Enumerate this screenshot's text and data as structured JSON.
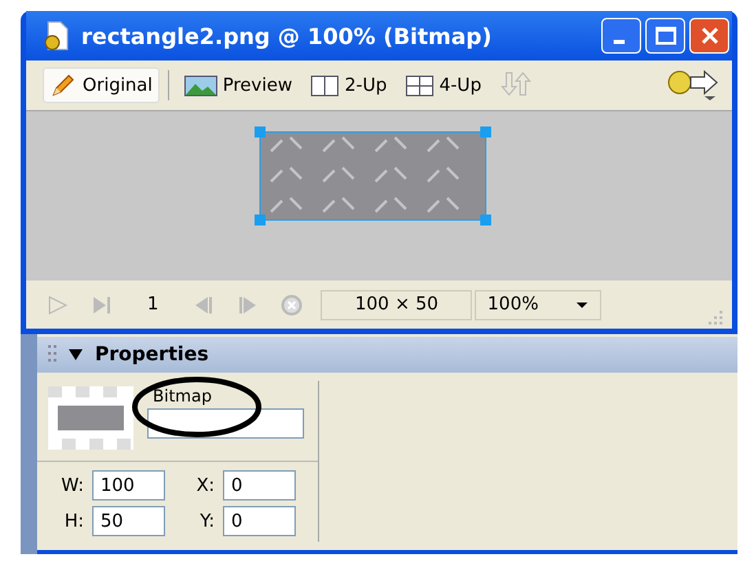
{
  "window": {
    "title": "rectangle2.png @ 100% (Bitmap)"
  },
  "view_tabs": [
    {
      "label": "Original",
      "kind": "pencil",
      "selected": true
    },
    {
      "label": "Preview",
      "kind": "landscape",
      "selected": false
    },
    {
      "label": "2-Up",
      "kind": "two-up",
      "selected": false
    },
    {
      "label": "4-Up",
      "kind": "four-up",
      "selected": false
    }
  ],
  "status_bar": {
    "frame": "1",
    "size": "100 × 50",
    "zoom": "100%"
  },
  "properties": {
    "title": "Properties",
    "expanded": true,
    "type": "Bitmap",
    "fields": [
      {
        "label": "W:",
        "value": "100"
      },
      {
        "label": "X:",
        "value": "0"
      },
      {
        "label": "H:",
        "value": "50"
      },
      {
        "label": "Y:",
        "value": "0"
      }
    ]
  }
}
